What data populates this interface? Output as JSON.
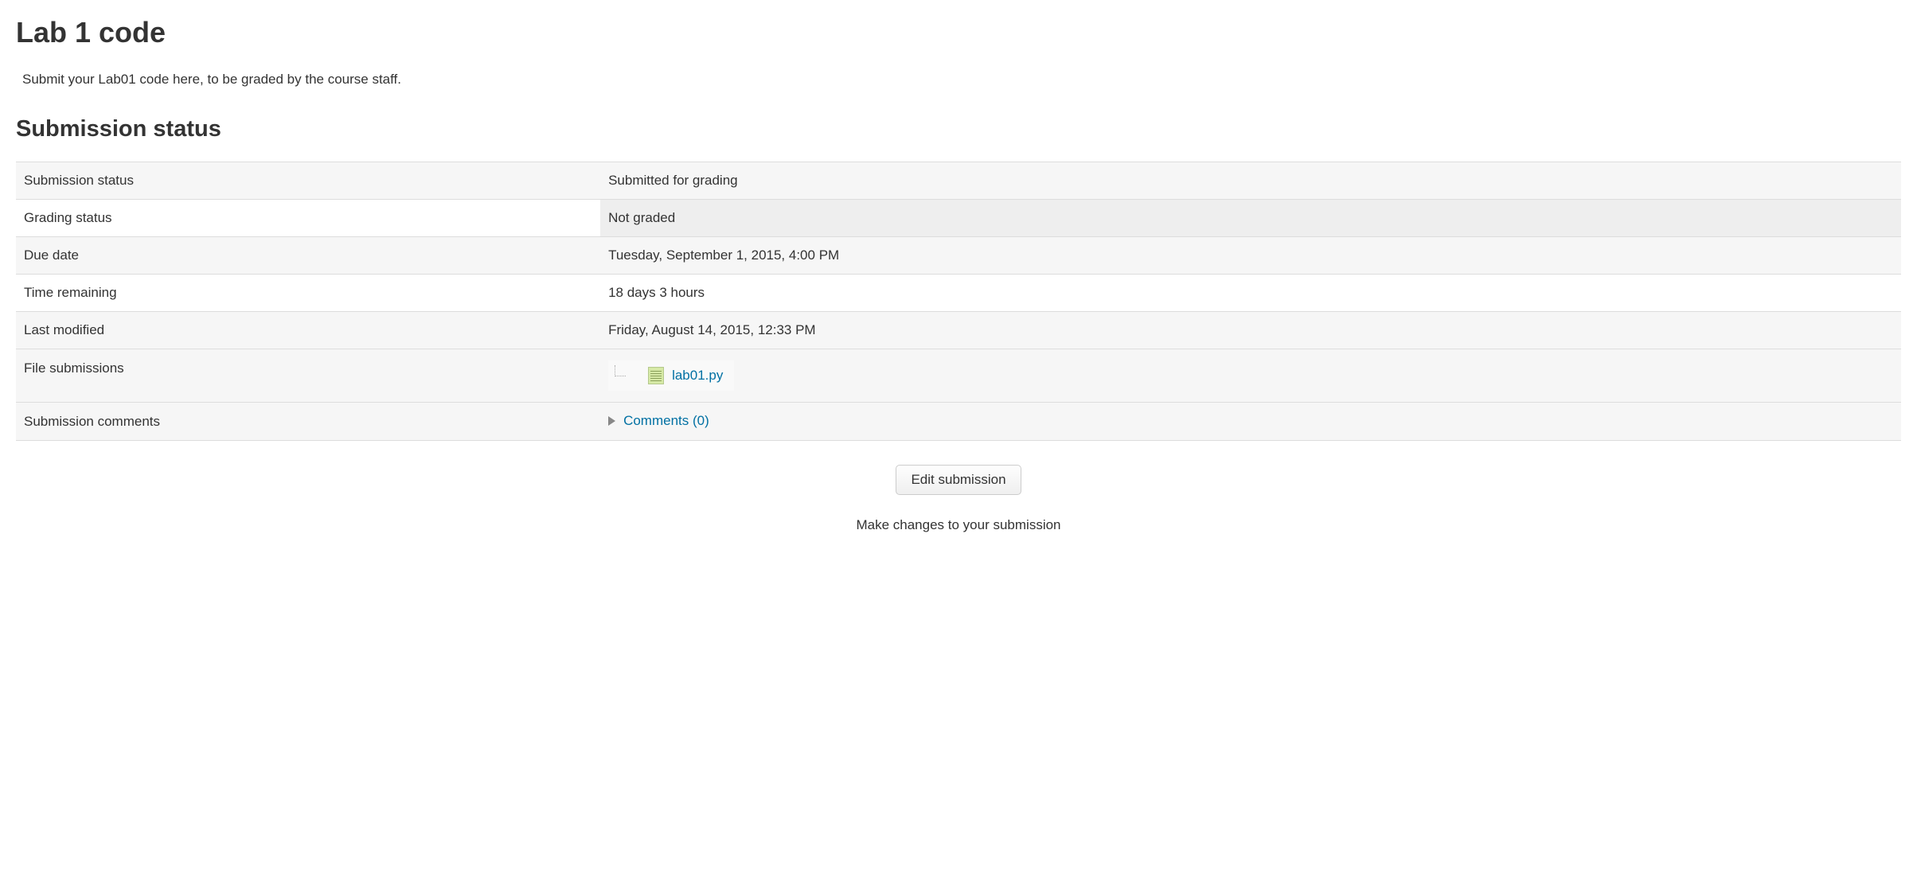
{
  "page": {
    "title": "Lab 1 code",
    "description": "Submit your Lab01 code here, to be graded by the course staff."
  },
  "section": {
    "title": "Submission status"
  },
  "rows": {
    "submission_status": {
      "label": "Submission status",
      "value": "Submitted for grading"
    },
    "grading_status": {
      "label": "Grading status",
      "value": "Not graded"
    },
    "due_date": {
      "label": "Due date",
      "value": "Tuesday, September 1, 2015, 4:00 PM"
    },
    "time_remaining": {
      "label": "Time remaining",
      "value": "18 days 3 hours"
    },
    "last_modified": {
      "label": "Last modified",
      "value": "Friday, August 14, 2015, 12:33 PM"
    },
    "file_submissions": {
      "label": "File submissions",
      "file_name": "lab01.py"
    },
    "submission_comments": {
      "label": "Submission comments",
      "link_text": "Comments (0)"
    }
  },
  "actions": {
    "edit_button": "Edit submission",
    "hint": "Make changes to your submission"
  }
}
